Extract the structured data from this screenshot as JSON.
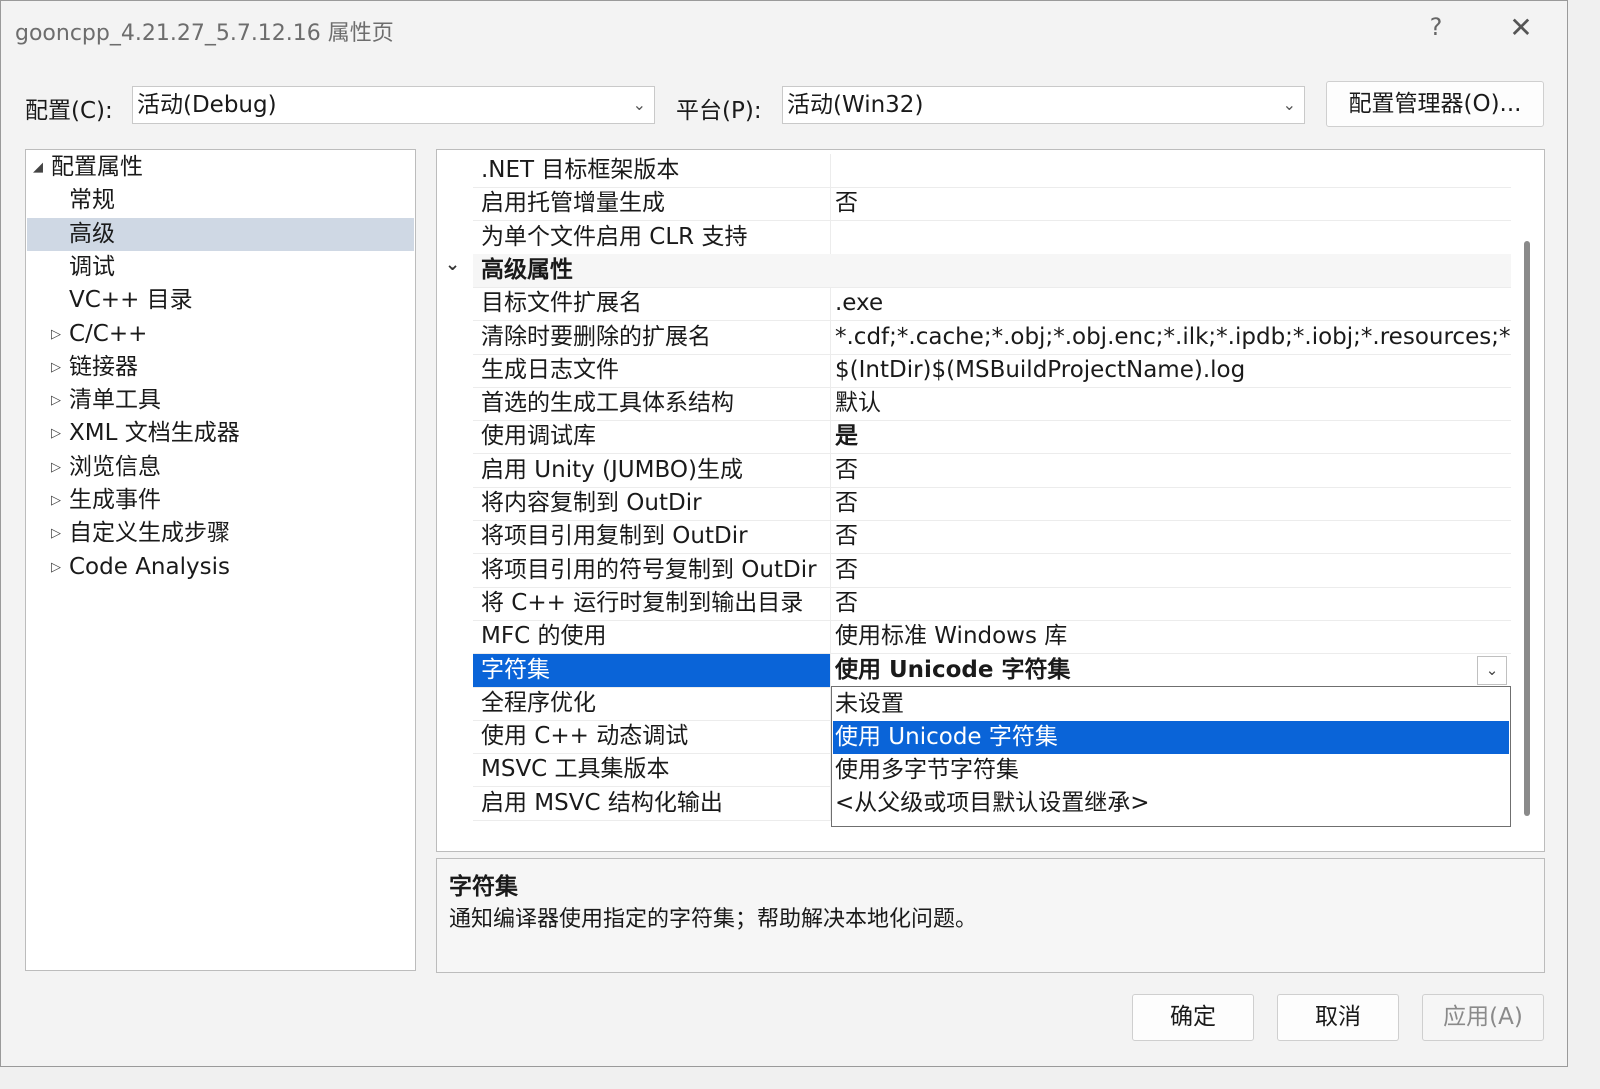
{
  "window": {
    "title": "gooncpp_4.21.27_5.7.12.16 属性页",
    "help_glyph": "?",
    "close_glyph": "✕"
  },
  "toolbar": {
    "config_label": "配置(C):",
    "config_value": "活动(Debug)",
    "platform_label": "平台(P):",
    "platform_value": "活动(Win32)",
    "config_manager_button": "配置管理器(O)..."
  },
  "tree": {
    "items": [
      {
        "label": "配置属性",
        "arrow": "◢"
      },
      {
        "label": "常规",
        "arrow": ""
      },
      {
        "label": "高级",
        "arrow": "",
        "selected": true
      },
      {
        "label": "调试",
        "arrow": ""
      },
      {
        "label": "VC++ 目录",
        "arrow": ""
      },
      {
        "label": "C/C++",
        "arrow": "▷"
      },
      {
        "label": "链接器",
        "arrow": "▷"
      },
      {
        "label": "清单工具",
        "arrow": "▷"
      },
      {
        "label": "XML 文档生成器",
        "arrow": "▷"
      },
      {
        "label": "浏览信息",
        "arrow": "▷"
      },
      {
        "label": "生成事件",
        "arrow": "▷"
      },
      {
        "label": "自定义生成步骤",
        "arrow": "▷"
      },
      {
        "label": "Code Analysis",
        "arrow": "▷"
      }
    ]
  },
  "grid": {
    "rows": [
      {
        "name": ".NET 目标框架版本",
        "value": ""
      },
      {
        "name": "启用托管增量生成",
        "value": "否"
      },
      {
        "name": "为单个文件启用 CLR 支持",
        "value": ""
      },
      {
        "name": "高级属性",
        "value": "",
        "category": true
      },
      {
        "name": "目标文件扩展名",
        "value": ".exe"
      },
      {
        "name": "清除时要删除的扩展名",
        "value": "*.cdf;*.cache;*.obj;*.obj.enc;*.ilk;*.ipdb;*.iobj;*.resources;*.tlb;*"
      },
      {
        "name": "生成日志文件",
        "value": "$(IntDir)$(MSBuildProjectName).log"
      },
      {
        "name": "首选的生成工具体系结构",
        "value": "默认"
      },
      {
        "name": "使用调试库",
        "value": "是",
        "bold": true
      },
      {
        "name": "启用 Unity (JUMBO)生成",
        "value": "否"
      },
      {
        "name": "将内容复制到 OutDir",
        "value": "否"
      },
      {
        "name": "将项目引用复制到 OutDir",
        "value": "否"
      },
      {
        "name": "将项目引用的符号复制到 OutDir",
        "value": "否"
      },
      {
        "name": "将 C++ 运行时复制到输出目录",
        "value": "否"
      },
      {
        "name": "MFC 的使用",
        "value": "使用标准 Windows 库"
      },
      {
        "name": "字符集",
        "value": "使用 Unicode 字符集",
        "bold": true,
        "selected": true
      },
      {
        "name": "全程序优化",
        "value": ""
      },
      {
        "name": "使用 C++ 动态调试",
        "value": ""
      },
      {
        "name": "MSVC 工具集版本",
        "value": ""
      },
      {
        "name": "启用 MSVC 结构化输出",
        "value": ""
      }
    ],
    "category_chevron": "❯",
    "dropdown_chevron": "⌵"
  },
  "dropdown": {
    "options": [
      {
        "label": "未设置"
      },
      {
        "label": "使用 Unicode 字符集",
        "highlighted": true
      },
      {
        "label": "使用多字节字符集"
      },
      {
        "label": "<从父级或项目默认设置继承>"
      }
    ]
  },
  "description": {
    "title": "字符集",
    "text": "通知编译器使用指定的字符集；帮助解决本地化问题。"
  },
  "footer": {
    "ok": "确定",
    "cancel": "取消",
    "apply": "应用(A)"
  },
  "colors": {
    "selection": "#0a64d8",
    "tree_selection": "#cfd8e4",
    "disabled_text": "#8a8a8a"
  }
}
